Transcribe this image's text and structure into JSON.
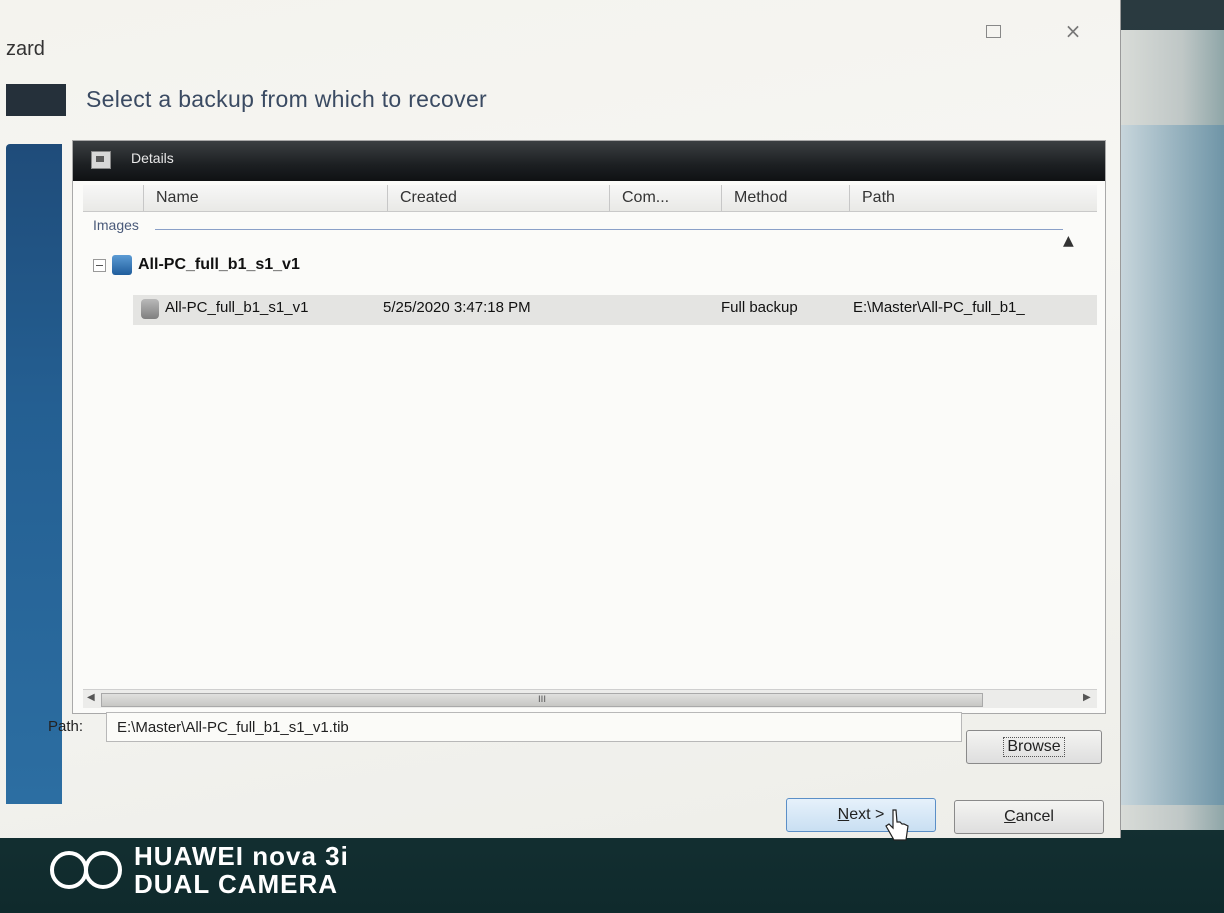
{
  "window": {
    "title_fragment": "zard",
    "heading": "Select a backup from which to recover",
    "close_glyph": "×"
  },
  "details_panel": {
    "header": "Details",
    "columns": [
      "Name",
      "Created",
      "Com...",
      "Method",
      "Path"
    ],
    "group_label": "Images",
    "parent_item": "All-PC_full_b1_s1_v1",
    "rows": [
      {
        "name": "All-PC_full_b1_s1_v1",
        "created": "5/25/2020 3:47:18 PM",
        "comment": "",
        "method": "Full backup",
        "path": "E:\\Master\\All-PC_full_b1_"
      }
    ],
    "scroll_grip": "III"
  },
  "path_field": {
    "label": "Path:",
    "value": "E:\\Master\\All-PC_full_b1_s1_v1.tib"
  },
  "buttons": {
    "browse": "Browse",
    "next_key": "N",
    "next_rest": "ext >",
    "cancel_key": "C",
    "cancel_rest": "ancel"
  },
  "watermark": {
    "line1": "HUAWEI nova 3i",
    "line2": "DUAL CAMERA"
  },
  "colors": {
    "nav_blue": "#245f92",
    "header_dark": "#1c1f22",
    "next_border": "#5b8fc7"
  },
  "icons": [
    "details-icon",
    "expander-icon",
    "disk-icon",
    "backup-disk-icon",
    "cursor-icon",
    "maximize-icon",
    "close-icon"
  ]
}
